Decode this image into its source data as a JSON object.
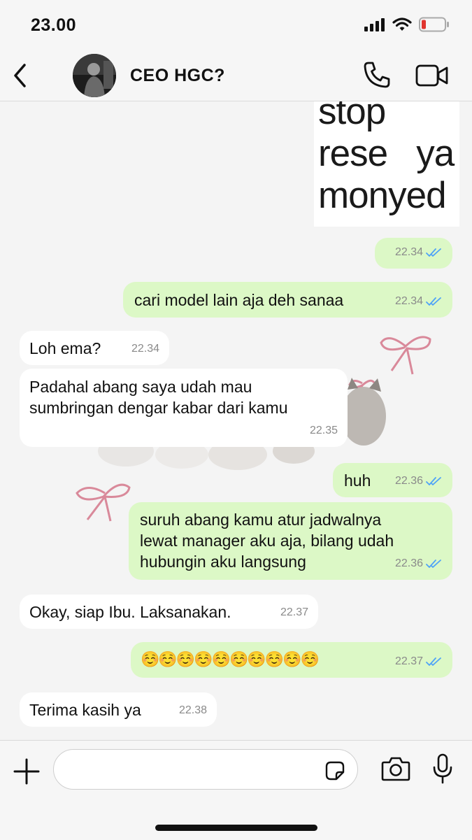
{
  "status": {
    "time": "23.00"
  },
  "header": {
    "contact_name": "CEO HGC?"
  },
  "sticker": {
    "lines": [
      "stop",
      "rese   ya",
      "monyed"
    ]
  },
  "messages": [
    {
      "dir": "out",
      "text": "",
      "time": "22.34",
      "read": true
    },
    {
      "dir": "out",
      "text": "cari model lain aja deh sanaa",
      "time": "22.34",
      "read": true
    },
    {
      "dir": "in",
      "text": "Loh ema?",
      "time": "22.34"
    },
    {
      "dir": "in",
      "text": "Padahal abang saya udah mau\nsumbringan dengar kabar dari kamu",
      "time": "22.35"
    },
    {
      "dir": "out",
      "text": "huh",
      "time": "22.36",
      "read": true
    },
    {
      "dir": "out",
      "text": "suruh abang kamu atur jadwalnya\nlewat manager aku aja, bilang udah\nhubungin aku langsung",
      "time": "22.36",
      "read": true
    },
    {
      "dir": "in",
      "text": "Okay, siap Ibu. Laksanakan.",
      "time": "22.37"
    },
    {
      "dir": "out",
      "text": "☺️☺️☺️☺️☺️☺️☺️☺️☺️☺️",
      "time": "22.37",
      "read": true
    },
    {
      "dir": "in",
      "text": "Terima kasih ya",
      "time": "22.38"
    }
  ],
  "composer": {
    "placeholder": ""
  },
  "icons": {
    "back": "chevron-left-icon",
    "call": "phone-icon",
    "video": "video-camera-icon",
    "add": "plus-icon",
    "sticker": "sticker-icon",
    "camera": "camera-icon",
    "mic": "microphone-icon",
    "read_receipt": "double-check-icon"
  },
  "colors": {
    "outgoing_bubble": "#dcf8c6",
    "incoming_bubble": "#ffffff",
    "read_tick": "#4fa3f7",
    "battery_low": "#e0342e"
  }
}
